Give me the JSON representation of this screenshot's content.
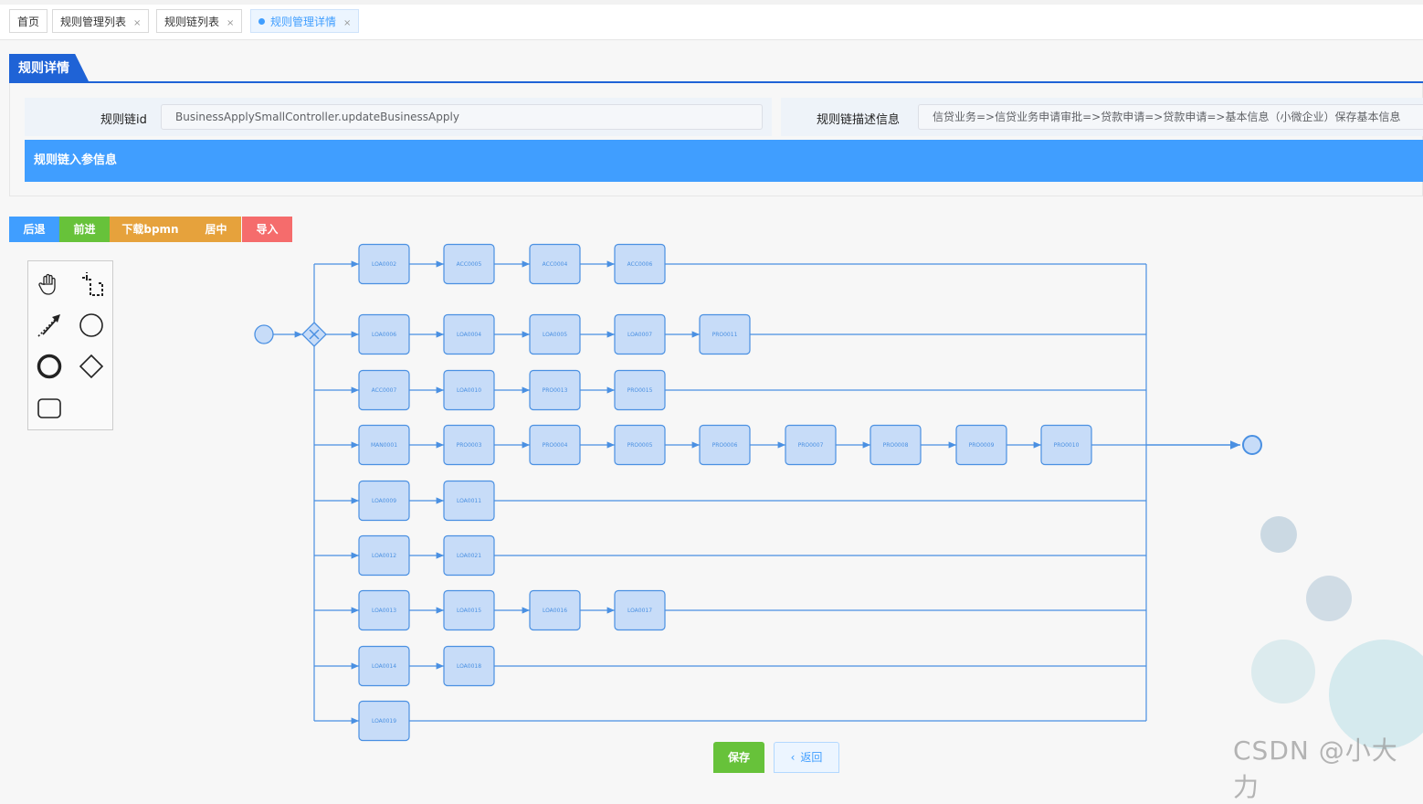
{
  "tabs": [
    {
      "label": "首页",
      "closable": false
    },
    {
      "label": "规则管理列表",
      "closable": true
    },
    {
      "label": "规则链列表",
      "closable": true
    },
    {
      "label": "规则管理详情",
      "closable": true,
      "active": true
    }
  ],
  "tab_close_glyph": "×",
  "section_title": "规则详情",
  "form": {
    "chain_id_label": "规则链id",
    "chain_id_value": "BusinessApplySmallController.updateBusinessApply",
    "desc_label": "规则链描述信息",
    "desc_value": "信贷业务=>信贷业务申请审批=>贷款申请=>贷款申请=>基本信息（小微企业）保存基本信息"
  },
  "params_bar": "规则链入参信息",
  "toolbar": {
    "back": "后退",
    "forward": "前进",
    "download": "下载bpmn",
    "center": "居中",
    "import": "导入"
  },
  "colors": {
    "primary": "#409eff",
    "success": "#67c23a",
    "warning": "#e6a23c",
    "danger": "#f56c6c",
    "header_blue": "#1f63d6"
  },
  "palette_icons": [
    "hand-tool-icon",
    "lasso-tool-icon",
    "connect-tool-icon",
    "start-event-icon",
    "end-event-icon",
    "gateway-icon",
    "task-icon"
  ],
  "diagram": {
    "rows": [
      [
        "LOA0002",
        "ACC0005",
        "ACC0004",
        "ACC0006"
      ],
      [
        "LOA0006",
        "LOA0004",
        "LOA0005",
        "LOA0007",
        "PRO0011"
      ],
      [
        "ACC0007",
        "LOA0010",
        "PRO0013",
        "PRO0015"
      ],
      [
        "MAN0001",
        "PRO0003",
        "PRO0004",
        "PRO0005",
        "PRO0006",
        "PRO0007",
        "PRO0008",
        "PRO0009",
        "PRO0010"
      ],
      [
        "LOA0009",
        "LOA0011"
      ],
      [
        "LOA0012",
        "LOA0021"
      ],
      [
        "LOA0013",
        "LOA0015",
        "LOA0016",
        "LOA0017"
      ],
      [
        "LOA0014",
        "LOA0018"
      ],
      [
        "LOA0019"
      ]
    ]
  },
  "footer": {
    "save": "保存",
    "back": "返回",
    "back_icon": "‹"
  },
  "watermark": "CSDN @小大力"
}
